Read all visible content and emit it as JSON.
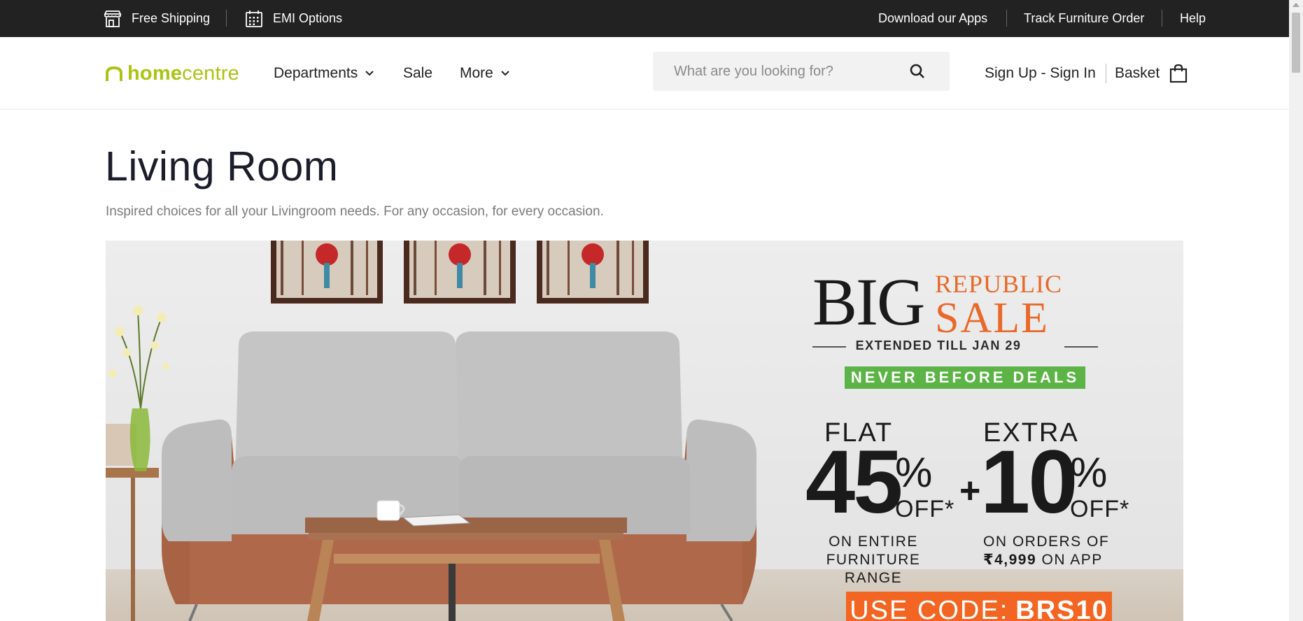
{
  "topbar": {
    "free_shipping": "Free Shipping",
    "emi_options": "EMI Options",
    "download_apps": "Download our Apps",
    "track_order": "Track Furniture Order",
    "help": "Help",
    "icons": {
      "free_shipping": "store-icon",
      "emi_options": "calendar-icon"
    }
  },
  "header": {
    "logo": {
      "part1": "home",
      "part2": "centre",
      "icon": "house-arch-icon",
      "color": "#a7c613"
    },
    "nav": {
      "departments": "Departments",
      "sale": "Sale",
      "more": "More"
    },
    "search": {
      "placeholder": "What are you looking for?",
      "value": "",
      "icon": "search-icon"
    },
    "account": "Sign Up - Sign In",
    "basket": "Basket",
    "basket_icon": "shopping-bag-icon"
  },
  "page": {
    "title": "Living Room",
    "subtitle": "Inspired choices for all your Livingroom needs. For any occasion, for every occasion."
  },
  "banner": {
    "big": "BIG",
    "republic": "REPUBLIC",
    "sale": "SALE",
    "extended": "EXTENDED TILL JAN 29",
    "never": "NEVER BEFORE DEALS",
    "flat": "FLAT",
    "flat_number": "45",
    "percent": "%",
    "off": "OFF*",
    "plus": "+",
    "extra": "EXTRA",
    "extra_number": "10",
    "flat_desc_1": "ON ENTIRE",
    "flat_desc_2": "FURNITURE RANGE",
    "extra_desc_1": "ON ORDERS OF",
    "extra_desc_2_amount": "₹4,999",
    "extra_desc_2_rest": "ON APP",
    "code_label": "USE CODE:",
    "code": "BRS10",
    "colors": {
      "accent_orange": "#e8692a",
      "green": "#5cb447",
      "code_bg": "#f26522"
    }
  }
}
